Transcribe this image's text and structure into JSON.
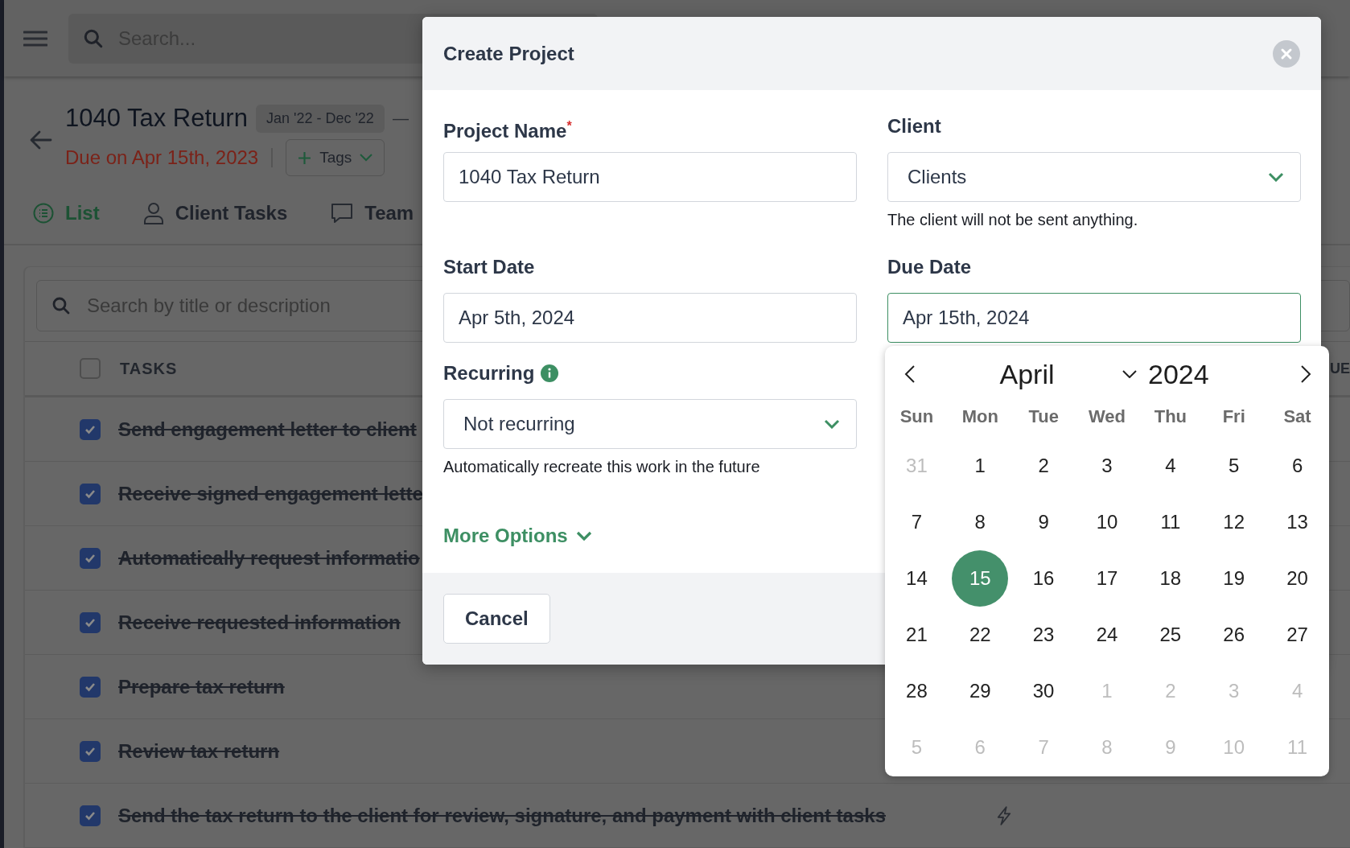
{
  "search": {
    "placeholder": "Search..."
  },
  "project": {
    "title": "1040 Tax Return",
    "period": "Jan '22 - Dec '22",
    "dash": "—",
    "due": "Due on Apr 15th, 2023",
    "tags_button": "Tags"
  },
  "tabs": [
    {
      "label": "List",
      "kind": "list",
      "selected": true
    },
    {
      "label": "Client Tasks",
      "kind": "person",
      "selected": false
    },
    {
      "label": "Team",
      "kind": "chat",
      "selected": false
    }
  ],
  "task_search": {
    "placeholder": "Search by title or description"
  },
  "table": {
    "select_all": false,
    "columns": [
      "TASKS",
      "UE"
    ],
    "rows": [
      {
        "title": "Send engagement letter to client",
        "checked": true,
        "automated": false
      },
      {
        "title": "Receive signed engagement lette",
        "checked": true,
        "automated": false
      },
      {
        "title": "Automatically request informatio",
        "checked": true,
        "automated": false
      },
      {
        "title": "Receive requested information",
        "checked": true,
        "automated": false
      },
      {
        "title": "Prepare tax return",
        "checked": true,
        "automated": false
      },
      {
        "title": "Review tax return",
        "checked": true,
        "automated": false
      },
      {
        "title": "Send the tax return to the client for review, signature, and payment with client tasks",
        "checked": true,
        "automated": true
      }
    ]
  },
  "modal": {
    "title": "Create Project",
    "project_name": {
      "label": "Project Name$^{*}$",
      "value": "1040 Tax Return"
    },
    "client": {
      "label": "Client",
      "value": "Clients",
      "help": "The client will not be sent anything."
    },
    "start_date": {
      "label": "Start Date",
      "value": "Apr 5th, 2024"
    },
    "due_date": {
      "label": "Due Date",
      "value": "Apr 15th, 2024",
      "focused": true
    },
    "recurring": {
      "label": "Recurring",
      "value": "Not recurring",
      "help": "Automatically recreate this work in the future"
    },
    "more_options": "More Options",
    "cancel_button": "Cancel"
  },
  "datepicker": {
    "month": "April",
    "year": "2024",
    "weekdays": [
      "Sun",
      "Mon",
      "Tue",
      "Wed",
      "Thu",
      "Fri",
      "Sat"
    ],
    "days": [
      {
        "label": "31",
        "outside": true,
        "selected": false
      },
      {
        "label": "1",
        "outside": false,
        "selected": false
      },
      {
        "label": "2",
        "outside": false,
        "selected": false
      },
      {
        "label": "3",
        "outside": false,
        "selected": false
      },
      {
        "label": "4",
        "outside": false,
        "selected": false
      },
      {
        "label": "5",
        "outside": false,
        "selected": false
      },
      {
        "label": "6",
        "outside": false,
        "selected": false
      },
      {
        "label": "7",
        "outside": false,
        "selected": false
      },
      {
        "label": "8",
        "outside": false,
        "selected": false
      },
      {
        "label": "9",
        "outside": false,
        "selected": false
      },
      {
        "label": "10",
        "outside": false,
        "selected": false
      },
      {
        "label": "11",
        "outside": false,
        "selected": false
      },
      {
        "label": "12",
        "outside": false,
        "selected": false
      },
      {
        "label": "13",
        "outside": false,
        "selected": false
      },
      {
        "label": "14",
        "outside": false,
        "selected": false
      },
      {
        "label": "15",
        "outside": false,
        "selected": true
      },
      {
        "label": "16",
        "outside": false,
        "selected": false
      },
      {
        "label": "17",
        "outside": false,
        "selected": false
      },
      {
        "label": "18",
        "outside": false,
        "selected": false
      },
      {
        "label": "19",
        "outside": false,
        "selected": false
      },
      {
        "label": "20",
        "outside": false,
        "selected": false
      },
      {
        "label": "21",
        "outside": false,
        "selected": false
      },
      {
        "label": "22",
        "outside": false,
        "selected": false
      },
      {
        "label": "23",
        "outside": false,
        "selected": false
      },
      {
        "label": "24",
        "outside": false,
        "selected": false
      },
      {
        "label": "25",
        "outside": false,
        "selected": false
      },
      {
        "label": "26",
        "outside": false,
        "selected": false
      },
      {
        "label": "27",
        "outside": false,
        "selected": false
      },
      {
        "label": "28",
        "outside": false,
        "selected": false
      },
      {
        "label": "29",
        "outside": false,
        "selected": false
      },
      {
        "label": "30",
        "outside": false,
        "selected": false
      },
      {
        "label": "1",
        "outside": true,
        "selected": false
      },
      {
        "label": "2",
        "outside": true,
        "selected": false
      },
      {
        "label": "3",
        "outside": true,
        "selected": false
      },
      {
        "label": "4",
        "outside": true,
        "selected": false
      },
      {
        "label": "5",
        "outside": true,
        "selected": false
      },
      {
        "label": "6",
        "outside": true,
        "selected": false
      },
      {
        "label": "7",
        "outside": true,
        "selected": false
      },
      {
        "label": "8",
        "outside": true,
        "selected": false
      },
      {
        "label": "9",
        "outside": true,
        "selected": false
      },
      {
        "label": "10",
        "outside": true,
        "selected": false
      },
      {
        "label": "11",
        "outside": true,
        "selected": false
      }
    ]
  }
}
